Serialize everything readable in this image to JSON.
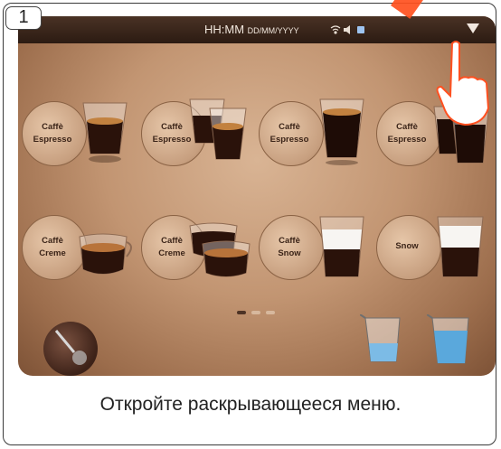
{
  "step": {
    "number": "1"
  },
  "topbar": {
    "time": "HH:MM",
    "date": "DD/MM/YYYY",
    "icons": [
      "wifi-icon",
      "volume-icon",
      "user-icon"
    ],
    "menu_icon": "chevron-down-icon"
  },
  "drinks_row1": [
    {
      "line1": "Caffè",
      "line2": "Espresso",
      "icon": "espresso-cup"
    },
    {
      "line1": "Caffè",
      "line2": "Espresso",
      "icon": "double-espresso-cup"
    },
    {
      "line1": "Caffè",
      "line2": "Espresso",
      "icon": "espresso-cup"
    },
    {
      "line1": "Caffè",
      "line2": "Espresso",
      "icon": "double-espresso-cup"
    }
  ],
  "drinks_row2": [
    {
      "line1": "Caffè",
      "line2": "Creme",
      "icon": "creme-cup"
    },
    {
      "line1": "Caffè",
      "line2": "Creme",
      "icon": "double-creme-cup"
    },
    {
      "line1": "Caffè",
      "line2": "Snow",
      "icon": "snow-glass"
    },
    {
      "line1": "Snow",
      "line2": "",
      "icon": "snow-glass"
    }
  ],
  "pager": {
    "pages": 3,
    "current": 1
  },
  "bottom": {
    "left_icon": "steam-wand-icon",
    "right_icons": [
      "milk-jug-icon",
      "milk-jug-icon"
    ]
  },
  "caption": "Откройте раскрывающееся меню.",
  "colors": {
    "accent_pointer": "#ff5020",
    "topbar": "#2c1b12",
    "background": "#c29572"
  }
}
